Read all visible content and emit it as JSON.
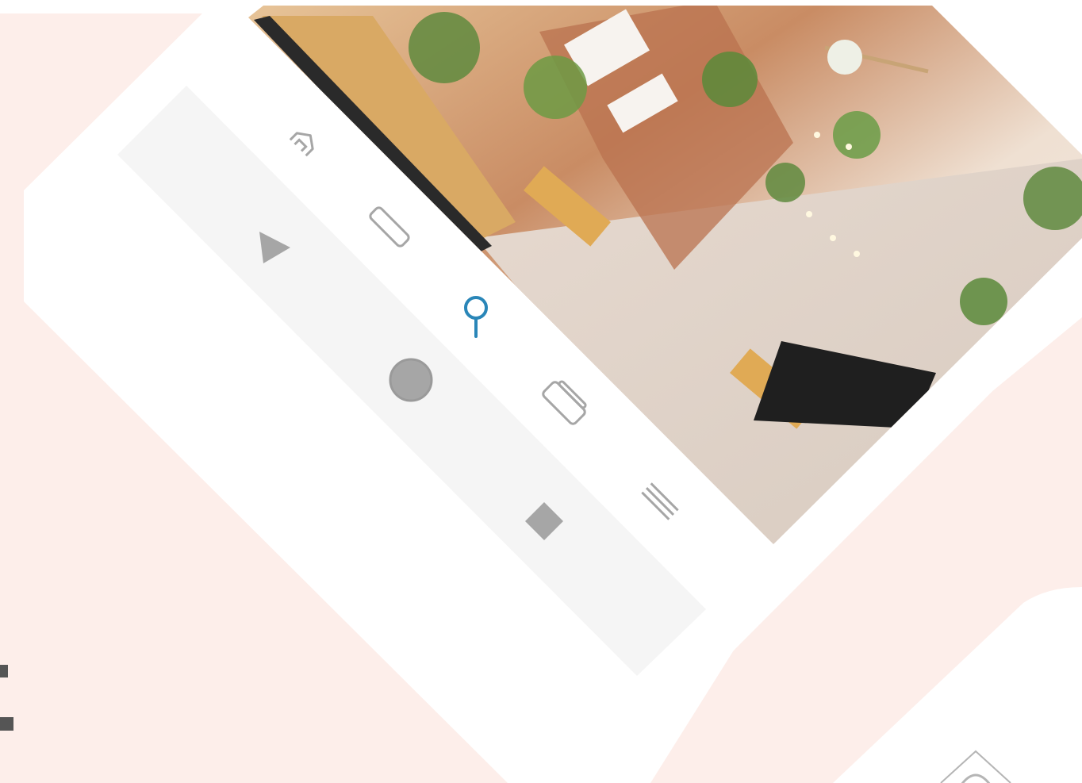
{
  "theme": {
    "background_pink": "#fdeeea",
    "device_white": "#ffffff",
    "bottom_bar_gray": "#f5f5f5",
    "icon_gray": "#a6a6a6",
    "accent_blue": "#2a86b8",
    "edge_mark_dark": "#555555"
  },
  "photo": {
    "description_icon": "cafe-interior-photo"
  },
  "nav_bar": {
    "items": [
      {
        "id": "home",
        "icon": "home-icon",
        "active": false
      },
      {
        "id": "library",
        "icon": "rounded-rectangle-icon",
        "active": false
      },
      {
        "id": "search",
        "icon": "search-icon",
        "active": true
      },
      {
        "id": "cards",
        "icon": "stacked-cards-icon",
        "active": false
      },
      {
        "id": "menu",
        "icon": "menu-lines-icon",
        "active": false
      }
    ]
  },
  "system_bar": {
    "items": [
      {
        "id": "back",
        "icon": "back-triangle-icon"
      },
      {
        "id": "home",
        "icon": "home-circle-icon"
      },
      {
        "id": "recents",
        "icon": "recents-square-icon"
      }
    ]
  }
}
